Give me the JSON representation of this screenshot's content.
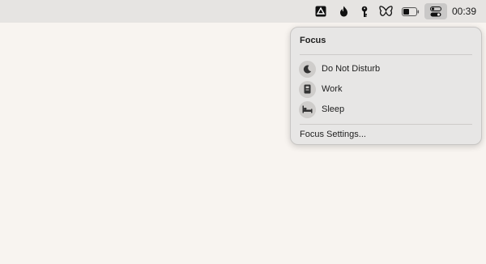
{
  "menubar": {
    "clock": "00:39",
    "icons": [
      "app-drive-icon",
      "flame-icon",
      "key-icon",
      "butterfly-icon",
      "battery-icon",
      "control-center-icon"
    ]
  },
  "focus_panel": {
    "title": "Focus",
    "items": [
      {
        "label": "Do Not Disturb",
        "icon": "moon-icon"
      },
      {
        "label": "Work",
        "icon": "work-badge-icon"
      },
      {
        "label": "Sleep",
        "icon": "bed-icon"
      }
    ],
    "settings_label": "Focus Settings..."
  },
  "colors": {
    "desktop": "#f8f4f0",
    "menubar": "#e6e4e2",
    "panel": "#e7e6e5"
  }
}
